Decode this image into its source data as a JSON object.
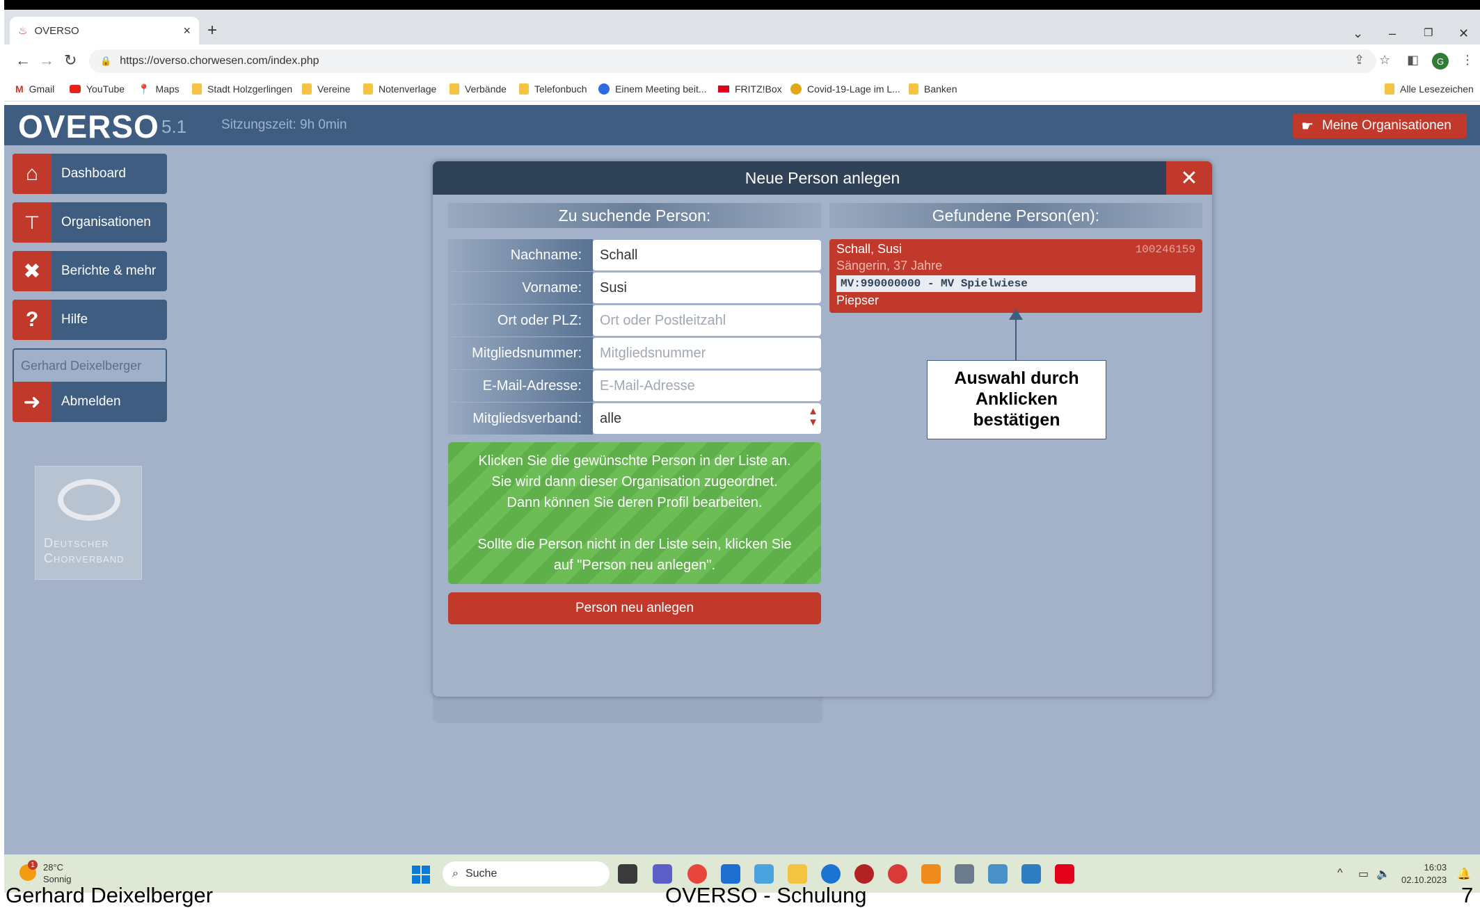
{
  "browser": {
    "tab_title": "OVERSO",
    "tab_close": "×",
    "new_tab": "+",
    "url": "https://overso.chorwesen.com/index.php",
    "profile_initial": "G",
    "bookmarks": [
      "Gmail",
      "YouTube",
      "Maps",
      "Stadt Holzgerlingen",
      "Vereine",
      "Notenverlage",
      "Verbände",
      "Telefonbuch",
      "Einem Meeting beit...",
      "FRITZ!Box",
      "Covid-19-Lage im L...",
      "Banken"
    ],
    "all_bookmarks": "Alle Lesezeichen"
  },
  "app": {
    "logo": "OVERSO",
    "version": "5.1",
    "session": "Sitzungszeit: 9h 0min",
    "my_orgs": "Meine Organisationen"
  },
  "sidebar": {
    "items": [
      {
        "label": "Dashboard",
        "icon": "home-icon"
      },
      {
        "label": "Organisationen",
        "icon": "org-chart-icon"
      },
      {
        "label": "Berichte & mehr",
        "icon": "tools-icon"
      },
      {
        "label": "Hilfe",
        "icon": "question-icon"
      }
    ],
    "user": "Gerhard Deixelberger",
    "logout": "Abmelden",
    "dcv_line1": "Deutscher",
    "dcv_line2": "Chorverband"
  },
  "modal": {
    "title": "Neue Person anlegen",
    "close": "✕",
    "search_head": "Zu suchende Person:",
    "results_head": "Gefundene Person(en):",
    "fields": {
      "nachname_label": "Nachname:",
      "nachname_value": "Schall",
      "vorname_label": "Vorname:",
      "vorname_value": "Susi",
      "ort_label": "Ort oder PLZ:",
      "ort_placeholder": "Ort oder Postleitzahl",
      "mitglied_label": "Mitgliedsnummer:",
      "mitglied_placeholder": "Mitgliedsnummer",
      "email_label": "E-Mail-Adresse:",
      "email_placeholder": "E-Mail-Adresse",
      "verband_label": "Mitgliedsverband:",
      "verband_value": "alle"
    },
    "info_line1": "Klicken Sie die gewünschte Person in der Liste an.",
    "info_line2": "Sie wird dann dieser Organisation zugeordnet.",
    "info_line3": "Dann können Sie deren Profil bearbeiten.",
    "info_line4": "Sollte die Person nicht in der Liste sein, klicken Sie",
    "info_line5": "auf \"Person neu anlegen\".",
    "new_person_button": "Person neu anlegen",
    "result": {
      "name": "Schall, Susi",
      "number": "100246159",
      "role": "Sängerin, 37 Jahre",
      "mv": "MV:990000000 - MV Spielwiese",
      "choir": "Piepser"
    },
    "callout_line1": "Auswahl durch",
    "callout_line2": "Anklicken",
    "callout_line3": "bestätigen"
  },
  "taskbar": {
    "temp": "28°C",
    "weather": "Sonnig",
    "weather_badge": "1",
    "search": "Suche",
    "time": "16:03",
    "date": "02.10.2023"
  },
  "footer": {
    "author": "Gerhard Deixelberger",
    "title": "OVERSO - Schulung",
    "page": "7"
  },
  "colors": {
    "header_blue": "#3f5d81",
    "accent_red": "#c0392b",
    "modal_title": "#2f4257",
    "info_green": "#5fb04a",
    "background": "#a3b2c8"
  }
}
